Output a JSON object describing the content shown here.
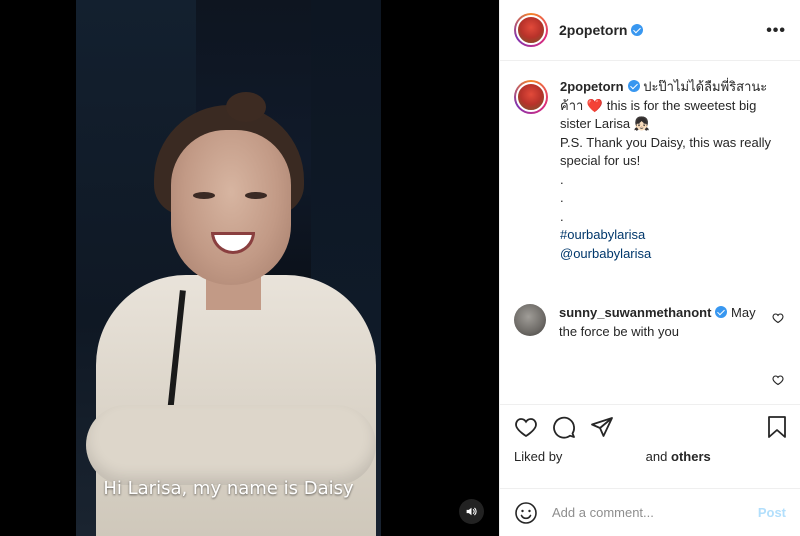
{
  "video": {
    "caption": "Hi Larisa, my name is Daisy",
    "sound_icon": "speaker-icon"
  },
  "header": {
    "username": "2popetorn",
    "verified": true,
    "more_icon": "more-options-icon",
    "more_label": "•••"
  },
  "post_caption": {
    "username": "2popetorn",
    "line1": "ปะป๊าไม่ได้ลืมพี่ริสานะค้าา",
    "heart": "❤️",
    "line2": "this is for the sweetest big sister Larisa",
    "emoji_girl": "👧🏻",
    "ps": "P.S. Thank you Daisy, this was really special for us!",
    "dots": [
      ".",
      ".",
      "."
    ],
    "hashtag": "#ourbabylarisa",
    "mention": "@ourbabylarisa"
  },
  "comments": [
    {
      "username": "sunny_suwanmethanont",
      "verified": true,
      "text": "May the force be with you"
    }
  ],
  "actions": {
    "icons": [
      "heart-icon",
      "comment-icon",
      "share-icon",
      "bookmark-icon"
    ],
    "liked_prefix": "Liked by",
    "liked_suffix": "and",
    "liked_others": "others"
  },
  "add_comment": {
    "placeholder": "Add a comment...",
    "post_label": "Post",
    "emoji_icon": "emoji-icon"
  },
  "colors": {
    "link": "#00376b",
    "verified": "#3897f0",
    "post_disabled": "#b2dffc",
    "heart": "#ed4956"
  }
}
